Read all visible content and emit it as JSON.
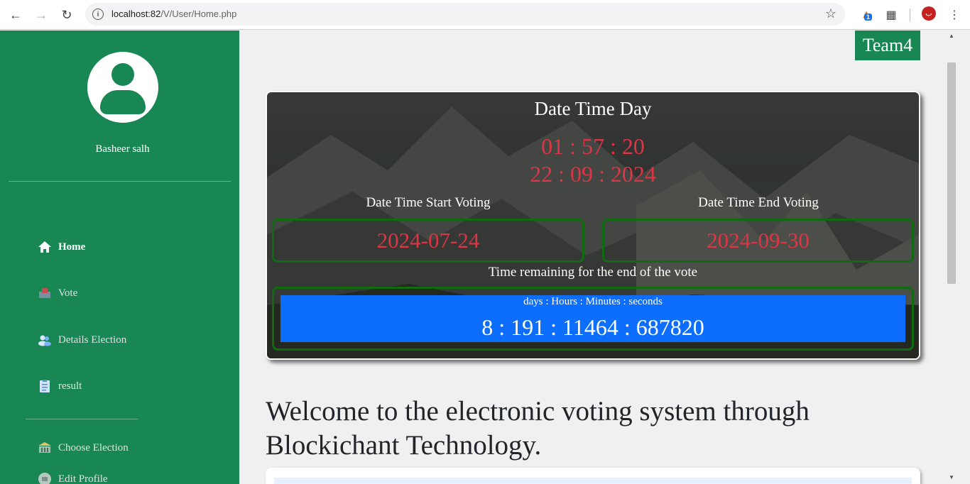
{
  "browser": {
    "url_host": "localhost:82",
    "url_path": "/V/User/Home.php",
    "extension_badge": "1",
    "profile_initial": "ب"
  },
  "sidebar": {
    "username": "Basheer salh",
    "items": [
      {
        "label": "Home",
        "icon": "home-icon",
        "active": true
      },
      {
        "label": "Vote",
        "icon": "ballot-box-icon",
        "active": false
      },
      {
        "label": "Details Election",
        "icon": "people-icon",
        "active": false
      },
      {
        "label": "result",
        "icon": "clipboard-icon",
        "active": false
      },
      {
        "label": "Choose Election",
        "icon": "building-icon",
        "active": false
      },
      {
        "label": "Edit Profile",
        "icon": "profile-icon",
        "active": false
      }
    ],
    "bg_color": "#198754"
  },
  "header": {
    "team_badge": "Team4"
  },
  "card": {
    "title": "Date Time Day",
    "time": "01 : 57 : 20",
    "date": "22 : 09 : 2024",
    "start_label": "Date Time Start Voting",
    "start_value": "2024-07-24",
    "end_label": "Date Time End Voting",
    "end_value": "2024-09-30",
    "remaining_label": "Time remaining for the end of the vote",
    "remaining_units": "days : Hours : Minutes : seconds",
    "remaining_value": "8 : 191 : 11464 : 687820",
    "accent_red": "#dc3545",
    "accent_blue": "#0d6efd"
  },
  "main": {
    "welcome_line1": "Welcome to the electronic voting system through",
    "welcome_line2": "Blockichant Technology."
  }
}
